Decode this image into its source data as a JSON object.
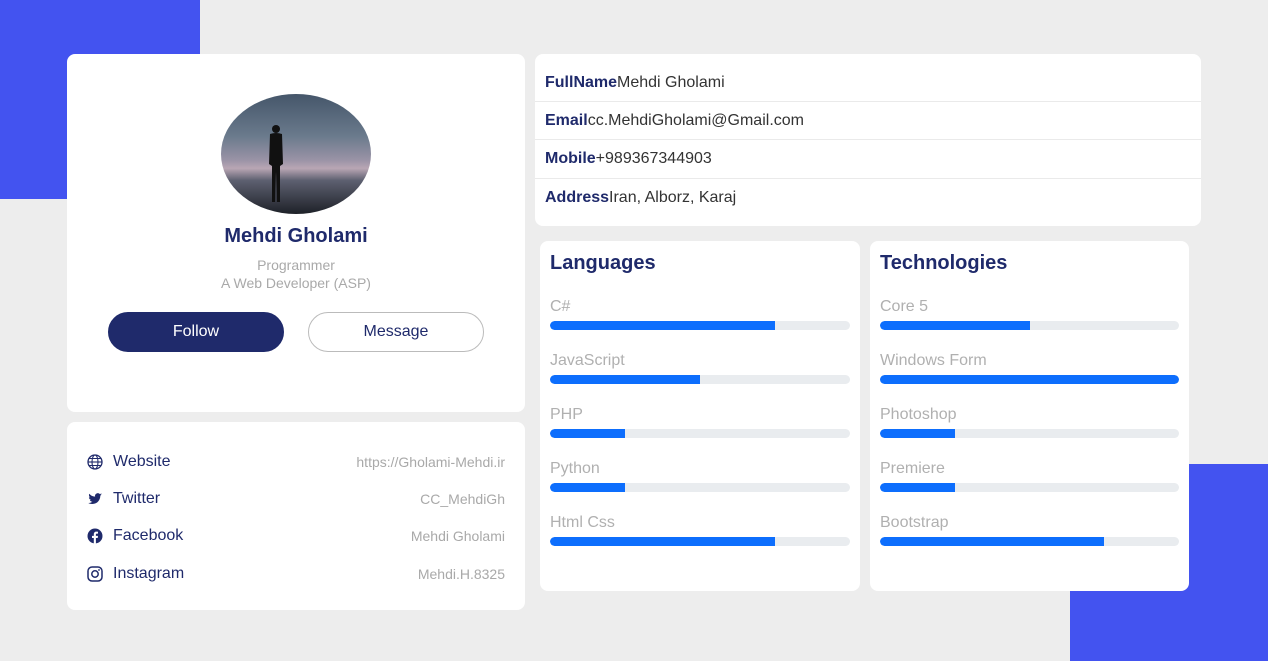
{
  "profile": {
    "name": "Mehdi Gholami",
    "role": "Programmer",
    "description": "A Web Developer (ASP)",
    "follow_label": "Follow",
    "message_label": "Message"
  },
  "social": [
    {
      "label": "Website",
      "value": "https://Gholami-Mehdi.ir",
      "icon": "globe-icon"
    },
    {
      "label": "Twitter",
      "value": "CC_MehdiGh",
      "icon": "twitter-icon"
    },
    {
      "label": "Facebook",
      "value": "Mehdi Gholami",
      "icon": "facebook-icon"
    },
    {
      "label": "Instagram",
      "value": "Mehdi.H.8325",
      "icon": "instagram-icon"
    }
  ],
  "info": [
    {
      "key": "FullName",
      "value": "Mehdi Gholami"
    },
    {
      "key": "Email",
      "value": "cc.MehdiGholami@Gmail.com"
    },
    {
      "key": "Mobile",
      "value": "+989367344903"
    },
    {
      "key": "Address",
      "value": "Iran, Alborz, Karaj"
    }
  ],
  "languages": {
    "title": "Languages",
    "items": [
      {
        "name": "C#",
        "percent": 75
      },
      {
        "name": "JavaScript",
        "percent": 50
      },
      {
        "name": "PHP",
        "percent": 25
      },
      {
        "name": "Python",
        "percent": 25
      },
      {
        "name": "Html Css",
        "percent": 75
      }
    ]
  },
  "technologies": {
    "title": "Technologies",
    "items": [
      {
        "name": "Core 5",
        "percent": 50
      },
      {
        "name": "Windows Form",
        "percent": 100
      },
      {
        "name": "Photoshop",
        "percent": 25
      },
      {
        "name": "Premiere",
        "percent": 25
      },
      {
        "name": "Bootstrap",
        "percent": 75
      }
    ]
  },
  "colors": {
    "accent": "#4353f0",
    "navy": "#1f2a6b",
    "progress": "#0d6efd",
    "track": "#e9ecef",
    "background": "#ededed"
  }
}
